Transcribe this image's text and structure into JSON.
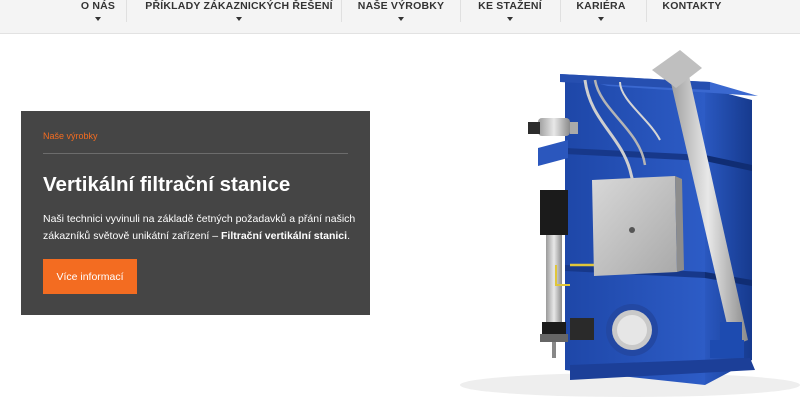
{
  "nav": {
    "items": [
      {
        "label": "O NÁS"
      },
      {
        "label": "PŘÍKLADY ZÁKAZNICKÝCH ŘEŠENÍ"
      },
      {
        "label": "NAŠE VÝROBKY"
      },
      {
        "label": "KE STAŽENÍ"
      },
      {
        "label": "KARIÉRA"
      },
      {
        "label": "KONTAKTY"
      }
    ]
  },
  "hero": {
    "kicker": "Naše výrobky",
    "title": "Vertikální filtrační stanice",
    "text_before": "Naši technici vyvinuli na základě četných požadavků a přání našich zákazníků světově unikátní zařízení – ",
    "text_bold": "Filtrační vertikální stanici",
    "text_after": ".",
    "button": "Více informací"
  },
  "colors": {
    "accent": "#f36c21",
    "card_background": "#454545",
    "nav_background": "#f4f4f4",
    "machine_blue": "#2350b4"
  }
}
